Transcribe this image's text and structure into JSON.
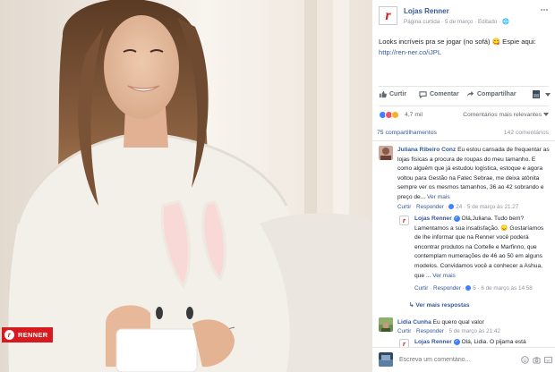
{
  "photo": {
    "brand_badge": "RENNER"
  },
  "post": {
    "page_name": "Lojas Renner",
    "page_type": "Página curtida",
    "date": "5 de março",
    "edited": "Editado",
    "text": "Looks incríveis pra se jogar (no sofá) 😋 Espie aqui:",
    "link": "http://ren-ner.co/iJPL"
  },
  "actions": {
    "like": "Curtir",
    "comment": "Comentar",
    "share": "Compartilhar"
  },
  "reactions": {
    "count": "4,7 mil",
    "relevance": "Comentários mais relevantes"
  },
  "counts": {
    "shares": "75 compartilhamentos",
    "comments": "142 comentários"
  },
  "comments": [
    {
      "author": "Juliana Ribeiro Conz",
      "text": "Eu estou cansada de frequentar as lojas físicas a procura de roupas do meu tamanho. E como alguém que já estudou logística, estoque e agora voltou para Gestão na Fatec Sebrae, me deixa atônita sempre ver os mesmos tamanhos, 36 ao 42 sobrando e preço de...",
      "see_more": "Ver mais",
      "like": "Curtir",
      "reply": "Responder",
      "reactions": "24",
      "time": "5 de março às 21:27"
    },
    {
      "author": "Lojas Renner",
      "text": "Olá,Juliana. Tudo bem? Lamentamos a sua insatisfação. 😞 Gostaríamos de lhe informar que na Renner você poderá encontrar produtos na Cortelle e Marfinno, que contemplam numerações de 46 ao 50 em alguns modelos. Convidamos você a conhecer a Ashua, que ...",
      "see_more": "Ver mais",
      "like": "Curtir",
      "reply": "Responder",
      "reactions": "5",
      "time": "6 de março às 14:58"
    },
    {
      "more_replies": "Ver mais respostas"
    },
    {
      "author": "Lidia Cunha",
      "text": "Eu quero qual valor",
      "like": "Curtir",
      "reply": "Responder",
      "time": "5 de março às 21:42"
    },
    {
      "author": "Lojas Renner",
      "text": "Olá, Lidia. O pijama está"
    }
  ],
  "compose": {
    "placeholder": "Escreva um comentário..."
  },
  "colors": {
    "brand": "#d71920",
    "link": "#365899",
    "meta": "#90949c",
    "verified": "#4080ff"
  }
}
